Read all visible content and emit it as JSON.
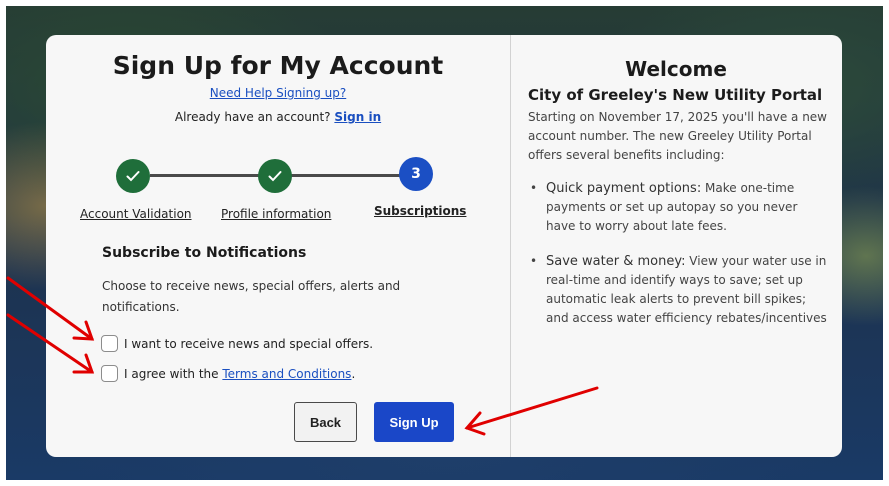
{
  "signup": {
    "title": "Sign Up for My Account",
    "help_link": "Need Help Signing up?",
    "have_account_text": "Already have an account?",
    "sign_in_link": "Sign in"
  },
  "steps": [
    {
      "label": "Account Validation",
      "state": "done"
    },
    {
      "label": "Profile information",
      "state": "done"
    },
    {
      "label": "Subscriptions",
      "state": "current",
      "number": "3"
    }
  ],
  "notifications": {
    "title": "Subscribe to Notifications",
    "description": "Choose to receive news, special offers, alerts and notifications.",
    "news_checkbox_label": "I want to receive news and special offers.",
    "terms_prefix": "I agree with the",
    "terms_link": "Terms and Conditions",
    "terms_suffix": "."
  },
  "buttons": {
    "back": "Back",
    "sign_up": "Sign Up"
  },
  "welcome": {
    "title": "Welcome",
    "portal_title": "City of Greeley's New Utility Portal",
    "intro": "Starting on November 17, 2025 you'll have a new account number. The new Greeley Utility Portal offers several benefits including:",
    "bullets": [
      {
        "lead": "Quick payment options:",
        "text": " Make one-time payments or set up autopay so you never have to worry about late fees."
      },
      {
        "lead": "Save water & money:",
        "text": " View your water use in real-time and identify ways to save; set up automatic leak alerts to prevent bill spikes; and access water efficiency rebates/incentives"
      }
    ]
  },
  "icons": {
    "check": "check-icon",
    "bullet": "•"
  },
  "colors": {
    "done_step": "#1f6e3a",
    "active_step": "#1b4fc4",
    "primary_button": "#1a47c8",
    "link": "#1a4fc0",
    "annotation_arrow": "#e00000"
  }
}
